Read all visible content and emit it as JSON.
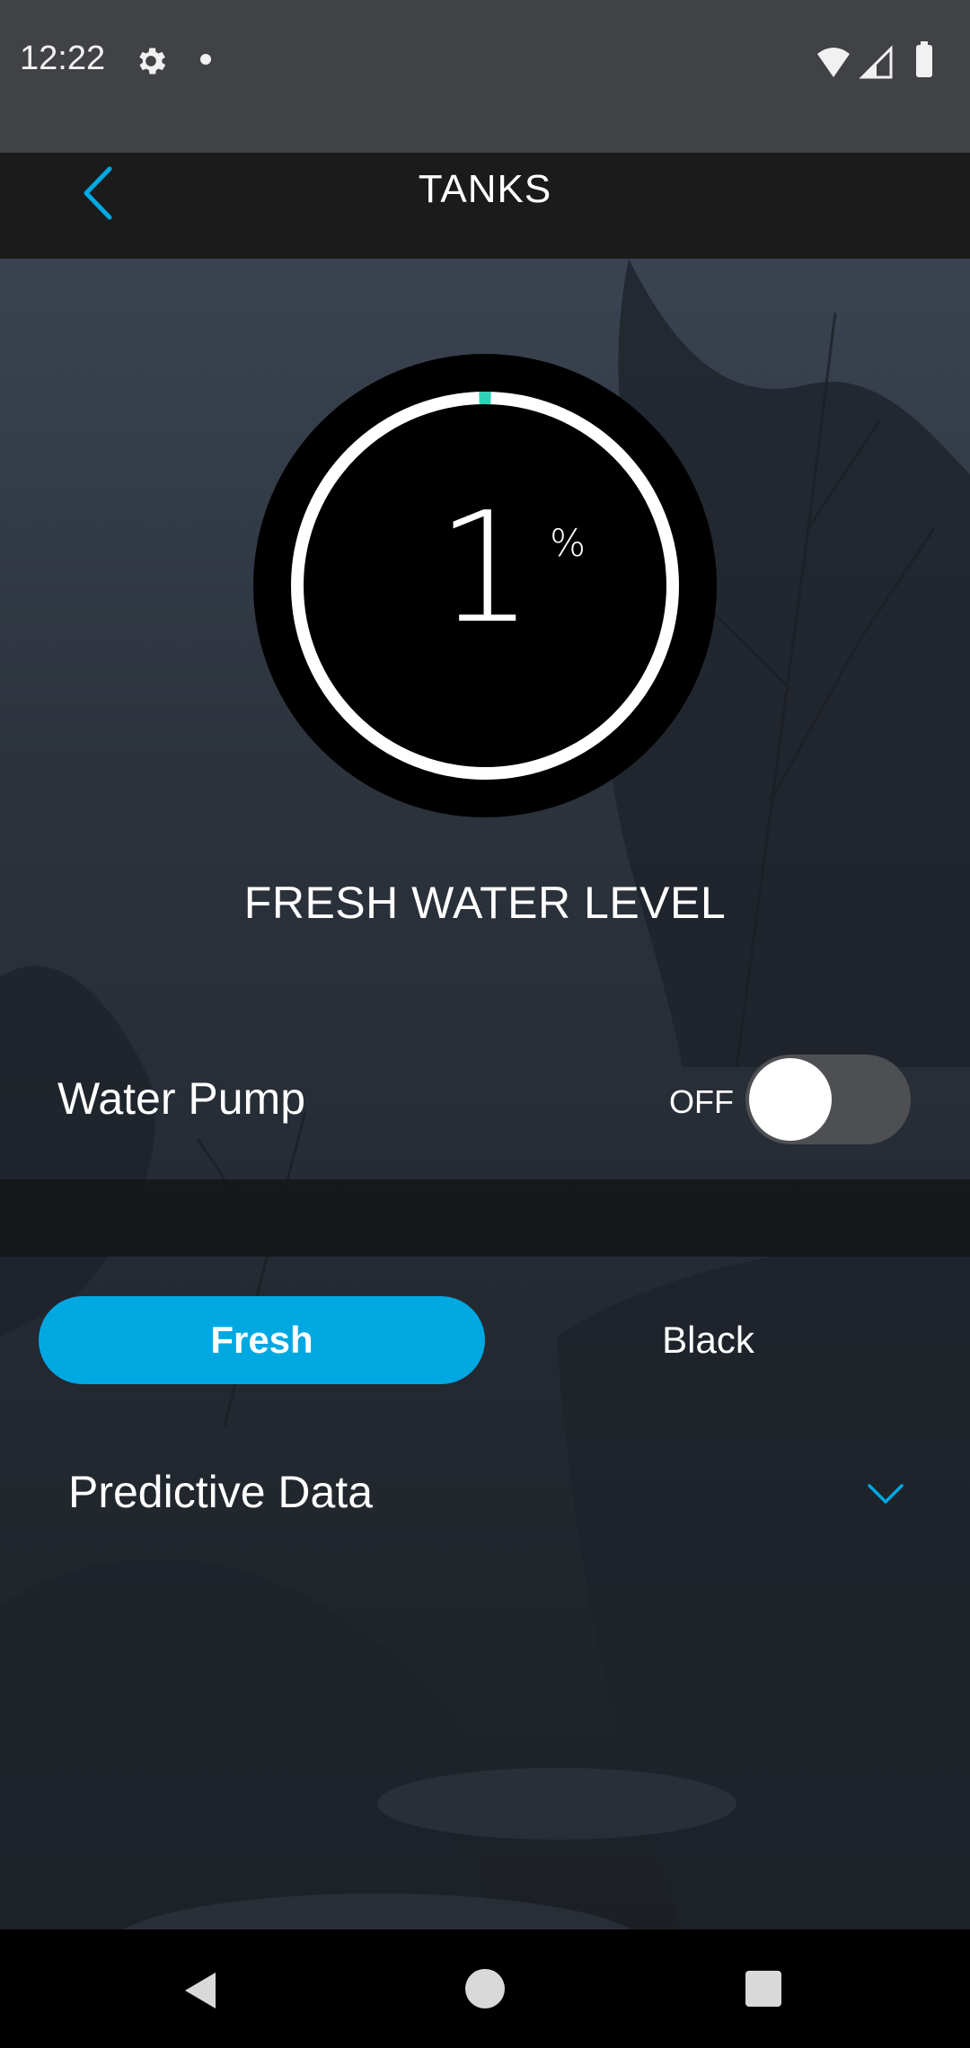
{
  "status_bar": {
    "time": "12:22"
  },
  "header": {
    "title": "TANKS"
  },
  "gauge": {
    "value": "1",
    "unit": "%",
    "level_fraction": 0.01,
    "label": "FRESH WATER LEVEL",
    "accent_color": "#2fd3b5"
  },
  "water_pump": {
    "label": "Water Pump",
    "state": "OFF",
    "on": false
  },
  "tabs": {
    "fresh": "Fresh",
    "black": "Black",
    "selected": "Fresh"
  },
  "predictive": {
    "label": "Predictive Data"
  },
  "colors": {
    "accent": "#00a8e1",
    "header_bg": "#1b1b1c",
    "status_bg": "#414245"
  }
}
